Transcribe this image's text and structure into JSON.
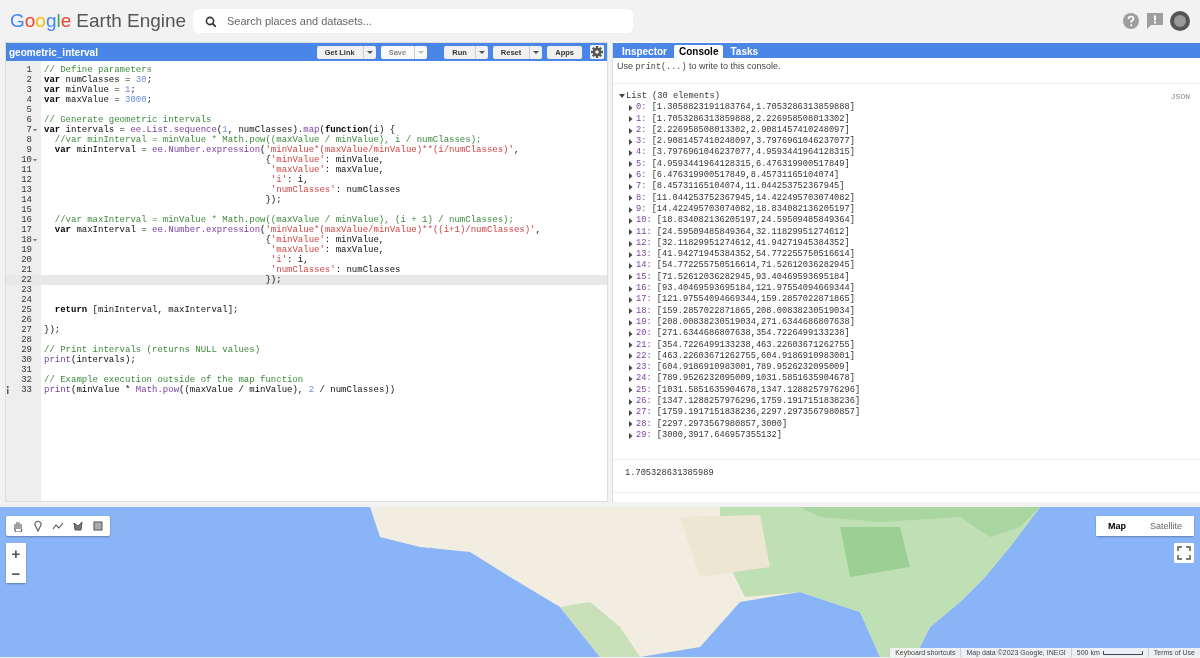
{
  "header": {
    "logo": {
      "brand": "Google",
      "product": "Earth Engine"
    },
    "search": {
      "placeholder": "Search places and datasets..."
    }
  },
  "editor": {
    "title": "geometric_interval",
    "buttons": [
      {
        "label": "Get Link",
        "dropdown": true,
        "disabled": false
      },
      {
        "label": "Save",
        "dropdown": true,
        "disabled": true
      },
      {
        "label": "Run",
        "dropdown": true,
        "disabled": false
      },
      {
        "label": "Reset",
        "dropdown": true,
        "disabled": false
      },
      {
        "label": "Apps",
        "dropdown": false,
        "disabled": false
      }
    ],
    "lines": [
      {
        "number": "1",
        "foldable": false,
        "info": false,
        "selected": false,
        "tokens": [
          {
            "kind": "comment",
            "text": "// Define parameters"
          }
        ]
      },
      {
        "number": "2",
        "foldable": false,
        "info": false,
        "selected": false,
        "tokens": [
          {
            "kind": "keyword",
            "text": "var"
          },
          {
            "kind": "plain",
            "text": " numClasses = "
          },
          {
            "kind": "number",
            "text": "30"
          },
          {
            "kind": "plain",
            "text": ";"
          }
        ]
      },
      {
        "number": "3",
        "foldable": false,
        "info": false,
        "selected": false,
        "tokens": [
          {
            "kind": "keyword",
            "text": "var"
          },
          {
            "kind": "plain",
            "text": " minValue = "
          },
          {
            "kind": "number",
            "text": "1"
          },
          {
            "kind": "plain",
            "text": ";"
          }
        ]
      },
      {
        "number": "4",
        "foldable": false,
        "info": false,
        "selected": false,
        "tokens": [
          {
            "kind": "keyword",
            "text": "var"
          },
          {
            "kind": "plain",
            "text": " maxValue = "
          },
          {
            "kind": "number",
            "text": "3000"
          },
          {
            "kind": "plain",
            "text": ";"
          }
        ]
      },
      {
        "number": "5",
        "foldable": false,
        "info": false,
        "selected": false
      },
      {
        "number": "6",
        "foldable": false,
        "info": false,
        "selected": false,
        "tokens": [
          {
            "kind": "comment",
            "text": "// Generate geometric intervals"
          }
        ]
      },
      {
        "number": "7",
        "foldable": true,
        "info": false,
        "selected": false,
        "tokens": [
          {
            "kind": "keyword",
            "text": "var"
          },
          {
            "kind": "plain",
            "text": " intervals = "
          },
          {
            "kind": "function",
            "text": "ee.List.sequence"
          },
          {
            "kind": "plain",
            "text": "("
          },
          {
            "kind": "number",
            "text": "1"
          },
          {
            "kind": "plain",
            "text": ", numClasses)."
          },
          {
            "kind": "function",
            "text": "map"
          },
          {
            "kind": "plain",
            "text": "("
          },
          {
            "kind": "keyword",
            "text": "function"
          },
          {
            "kind": "plain",
            "text": "(i) {"
          }
        ]
      },
      {
        "number": "8",
        "foldable": false,
        "info": false,
        "selected": false,
        "tokens": [
          {
            "kind": "comment",
            "text": "  //var minInterval = minValue * Math.pow((maxValue / minValue), i / numClasses);"
          }
        ]
      },
      {
        "number": "9",
        "foldable": false,
        "info": false,
        "selected": false,
        "tokens": [
          {
            "kind": "keyword",
            "text": "  var"
          },
          {
            "kind": "plain",
            "text": " minInterval = "
          },
          {
            "kind": "function",
            "text": "ee.Number.expression"
          },
          {
            "kind": "plain",
            "text": "("
          },
          {
            "kind": "string",
            "text": "'minValue*(maxValue/minValue)**(i/numClasses)'"
          },
          {
            "kind": "plain",
            "text": ","
          }
        ]
      },
      {
        "number": "10",
        "foldable": true,
        "info": false,
        "selected": false,
        "tokens": [
          {
            "kind": "plain",
            "text": "                                         {"
          },
          {
            "kind": "string",
            "text": "'minValue'"
          },
          {
            "kind": "plain",
            "text": ": minValue,"
          }
        ]
      },
      {
        "number": "11",
        "foldable": false,
        "info": false,
        "selected": false,
        "tokens": [
          {
            "kind": "string",
            "text": "                                          'maxValue'"
          },
          {
            "kind": "plain",
            "text": ": maxValue,"
          }
        ]
      },
      {
        "number": "12",
        "foldable": false,
        "info": false,
        "selected": false,
        "tokens": [
          {
            "kind": "string",
            "text": "                                          'i'"
          },
          {
            "kind": "plain",
            "text": ": i,"
          }
        ]
      },
      {
        "number": "13",
        "foldable": false,
        "info": false,
        "selected": false,
        "tokens": [
          {
            "kind": "string",
            "text": "                                          'numClasses'"
          },
          {
            "kind": "plain",
            "text": ": numClasses"
          }
        ]
      },
      {
        "number": "14",
        "foldable": false,
        "info": false,
        "selected": false,
        "tokens": [
          {
            "kind": "plain",
            "text": "                                         });"
          }
        ]
      },
      {
        "number": "15",
        "foldable": false,
        "info": false,
        "selected": false
      },
      {
        "number": "16",
        "foldable": false,
        "info": false,
        "selected": false,
        "tokens": [
          {
            "kind": "comment",
            "text": "  //var maxInterval = minValue * Math.pow((maxValue / minValue), (i + 1) / numClasses);"
          }
        ]
      },
      {
        "number": "17",
        "foldable": false,
        "info": false,
        "selected": false,
        "tokens": [
          {
            "kind": "keyword",
            "text": "  var"
          },
          {
            "kind": "plain",
            "text": " maxInterval = "
          },
          {
            "kind": "function",
            "text": "ee.Number.expression"
          },
          {
            "kind": "plain",
            "text": "("
          },
          {
            "kind": "string",
            "text": "'minValue*(maxValue/minValue)**((i+1)/numClasses)'"
          },
          {
            "kind": "plain",
            "text": ","
          }
        ]
      },
      {
        "number": "18",
        "foldable": true,
        "info": false,
        "selected": false,
        "tokens": [
          {
            "kind": "plain",
            "text": "                                         {"
          },
          {
            "kind": "string",
            "text": "'minValue'"
          },
          {
            "kind": "plain",
            "text": ": minValue,"
          }
        ]
      },
      {
        "number": "19",
        "foldable": false,
        "info": false,
        "selected": false,
        "tokens": [
          {
            "kind": "string",
            "text": "                                          'maxValue'"
          },
          {
            "kind": "plain",
            "text": ": maxValue,"
          }
        ]
      },
      {
        "number": "20",
        "foldable": false,
        "info": false,
        "selected": false,
        "tokens": [
          {
            "kind": "string",
            "text": "                                          'i'"
          },
          {
            "kind": "plain",
            "text": ": i,"
          }
        ]
      },
      {
        "number": "21",
        "foldable": false,
        "info": false,
        "selected": false,
        "tokens": [
          {
            "kind": "string",
            "text": "                                          'numClasses'"
          },
          {
            "kind": "plain",
            "text": ": numClasses"
          }
        ]
      },
      {
        "number": "22",
        "foldable": false,
        "info": false,
        "selected": true,
        "tokens": [
          {
            "kind": "plain",
            "text": "                                         });"
          }
        ]
      },
      {
        "number": "23",
        "foldable": false,
        "info": false,
        "selected": false
      },
      {
        "number": "24",
        "foldable": false,
        "info": false,
        "selected": false
      },
      {
        "number": "25",
        "foldable": false,
        "info": false,
        "selected": false,
        "tokens": [
          {
            "kind": "keyword",
            "text": "  return"
          },
          {
            "kind": "plain",
            "text": " [minInterval, maxInterval];"
          }
        ]
      },
      {
        "number": "26",
        "foldable": false,
        "info": false,
        "selected": false
      },
      {
        "number": "27",
        "foldable": false,
        "info": false,
        "selected": false,
        "tokens": [
          {
            "kind": "plain",
            "text": "});"
          }
        ]
      },
      {
        "number": "28",
        "foldable": false,
        "info": false,
        "selected": false
      },
      {
        "number": "29",
        "foldable": false,
        "info": false,
        "selected": false,
        "tokens": [
          {
            "kind": "comment",
            "text": "// Print intervals (returns NULL values)"
          }
        ]
      },
      {
        "number": "30",
        "foldable": false,
        "info": false,
        "selected": false,
        "tokens": [
          {
            "kind": "function",
            "text": "print"
          },
          {
            "kind": "plain",
            "text": "(intervals);"
          }
        ]
      },
      {
        "number": "31",
        "foldable": false,
        "info": false,
        "selected": false
      },
      {
        "number": "32",
        "foldable": false,
        "info": false,
        "selected": false,
        "tokens": [
          {
            "kind": "comment",
            "text": "// Example execution outside of the map function"
          }
        ]
      },
      {
        "number": "33",
        "foldable": false,
        "info": true,
        "selected": false,
        "tokens": [
          {
            "kind": "function",
            "text": "print"
          },
          {
            "kind": "plain",
            "text": "(minValue * "
          },
          {
            "kind": "function",
            "text": "Math.pow"
          },
          {
            "kind": "plain",
            "text": "((maxValue / minValue), "
          },
          {
            "kind": "number",
            "text": "2"
          },
          {
            "kind": "plain",
            "text": " / numClasses))"
          }
        ]
      }
    ]
  },
  "tabs": [
    {
      "label": "Inspector",
      "selected": false
    },
    {
      "label": "Console",
      "selected": true
    },
    {
      "label": "Tasks",
      "selected": false
    }
  ],
  "console": {
    "hint": {
      "before": "Use ",
      "code": "print(...)",
      "after": " to write to this console."
    },
    "list": {
      "label": "List (30 elements)",
      "expanded": true,
      "json_link": "JSON",
      "items": [
        {
          "index": "0:",
          "value": "[1.3058823191183764,1.7053286313859888]",
          "expanded": false
        },
        {
          "index": "1:",
          "value": "[1.7053286313859888,2.226958508013302]",
          "expanded": false
        },
        {
          "index": "2:",
          "value": "[2.226958508013302,2.9081457410248097]",
          "expanded": false
        },
        {
          "index": "3:",
          "value": "[2.9081457410248097,3.7976961046237077]",
          "expanded": false
        },
        {
          "index": "4:",
          "value": "[3.7976961046237077,4.9593441964128315]",
          "expanded": false
        },
        {
          "index": "5:",
          "value": "[4.9593441964128315,6.476319900517849]",
          "expanded": false
        },
        {
          "index": "6:",
          "value": "[6.476319900517849,8.45731165104074]",
          "expanded": false
        },
        {
          "index": "7:",
          "value": "[8.45731165104074,11.044253752367945]",
          "expanded": false
        },
        {
          "index": "8:",
          "value": "[11.044253752367945,14.422495703074082]",
          "expanded": false
        },
        {
          "index": "9:",
          "value": "[14.422495703074082,18.834082136205197]",
          "expanded": false
        },
        {
          "index": "10:",
          "value": "[18.834082136205197,24.59509485849364]",
          "expanded": false
        },
        {
          "index": "11:",
          "value": "[24.59509485849364,32.11829951274612]",
          "expanded": false
        },
        {
          "index": "12:",
          "value": "[32.11829951274612,41.94271945384352]",
          "expanded": false
        },
        {
          "index": "13:",
          "value": "[41.94271945384352,54.772255750516614]",
          "expanded": false
        },
        {
          "index": "14:",
          "value": "[54.772255750516614,71.52612036282945]",
          "expanded": false
        },
        {
          "index": "15:",
          "value": "[71.52612036282945,93.40469593695184]",
          "expanded": false
        },
        {
          "index": "16:",
          "value": "[93.40469593695184,121.97554094669344]",
          "expanded": false
        },
        {
          "index": "17:",
          "value": "[121.97554094669344,159.2857022871865]",
          "expanded": false
        },
        {
          "index": "18:",
          "value": "[159.2857022871865,208.00838230519034]",
          "expanded": false
        },
        {
          "index": "19:",
          "value": "[208.00838230519034,271.6344686807638]",
          "expanded": false
        },
        {
          "index": "20:",
          "value": "[271.6344686807638,354.7226499133238]",
          "expanded": false
        },
        {
          "index": "21:",
          "value": "[354.7226499133238,463.22603671262755]",
          "expanded": false
        },
        {
          "index": "22:",
          "value": "[463.22603671262755,604.9186910983001]",
          "expanded": false
        },
        {
          "index": "23:",
          "value": "[604.9186910983001,789.9526232095009]",
          "expanded": false
        },
        {
          "index": "24:",
          "value": "[789.9526232095009,1031.5851635904678]",
          "expanded": false
        },
        {
          "index": "25:",
          "value": "[1031.5851635904678,1347.1288257976296]",
          "expanded": false
        },
        {
          "index": "26:",
          "value": "[1347.1288257976296,1759.1917151838236]",
          "expanded": false
        },
        {
          "index": "27:",
          "value": "[1759.1917151838236,2297.2973567980857]",
          "expanded": false
        },
        {
          "index": "28:",
          "value": "[2297.2973567980857,3000]",
          "expanded": false
        },
        {
          "index": "29:",
          "value": "[3000,3917.646957355132]",
          "expanded": false
        }
      ]
    },
    "output": "1.705328631385989"
  },
  "map": {
    "zoom": [
      "+",
      "−"
    ],
    "types": [
      {
        "label": "Map",
        "selected": true
      },
      {
        "label": "Satellite",
        "selected": false
      }
    ],
    "attribution": [
      "Keyboard shortcuts",
      "Map data ©2023 Google, INEGI",
      "500 km",
      "Terms of Use"
    ]
  }
}
